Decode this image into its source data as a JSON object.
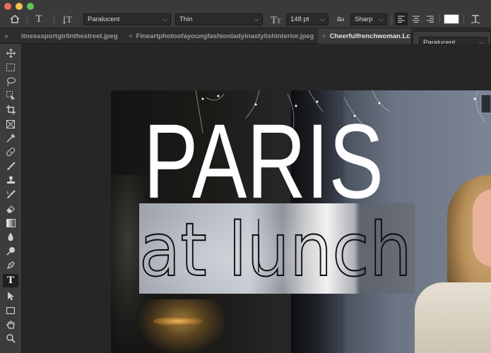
{
  "options_bar": {
    "font_family": "Paralucent",
    "font_style": "Thin",
    "font_size": "148 pt",
    "antialias_label": "a",
    "antialias_sub": "a",
    "antialias": "Sharp"
  },
  "tabs": [
    {
      "label": "itnesssportgirlinthestreet.jpeg",
      "active": false
    },
    {
      "label": "Fineartphotoofayoungfashionladyinastylishinterior.jpeg",
      "active": false
    },
    {
      "label": "Cheerfulfrenchwoman.Lc",
      "active": true
    }
  ],
  "font_popup": {
    "value": "Paralucent"
  },
  "canvas_text": {
    "headline": "PARIS",
    "subline": "at lunch"
  },
  "colors": {
    "text_color_swatch": "#ffffff",
    "accent": "#1f1f1f"
  }
}
